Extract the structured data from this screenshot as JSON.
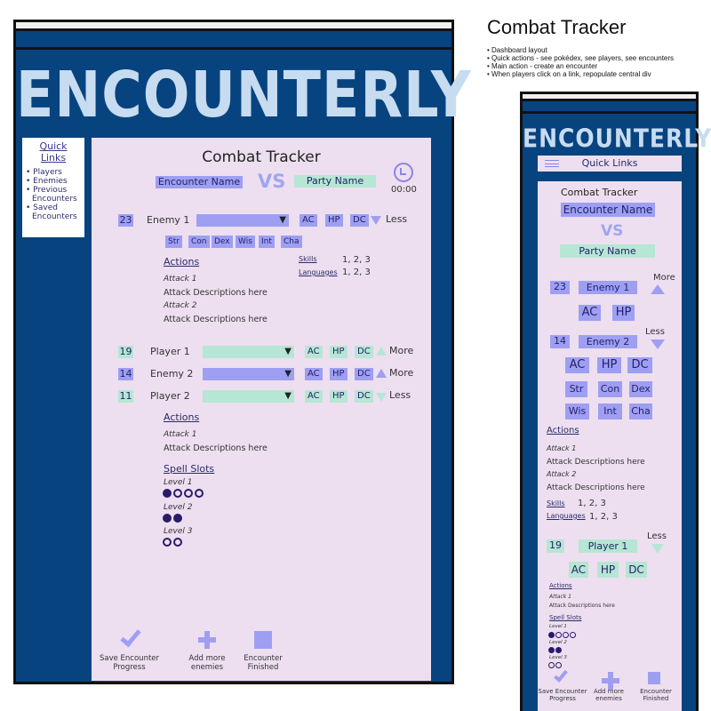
{
  "app": {
    "logo": "ENCOUNTERLY"
  },
  "quick_links": {
    "title": "Quick Links",
    "items": [
      "Players",
      "Enemies",
      "Previous Encounters",
      "Saved Encounters"
    ]
  },
  "tracker": {
    "title": "Combat Tracker",
    "encounter_name": "Encounter Name",
    "vs": "VS",
    "party_name": "Party Name",
    "timer": "00:00",
    "rows": [
      {
        "initiative": "23",
        "name": "Enemy 1",
        "toggle": "Less"
      },
      {
        "initiative": "19",
        "name": "Player 1",
        "toggle": "More"
      },
      {
        "initiative": "14",
        "name": "Enemy 2",
        "toggle": "More"
      },
      {
        "initiative": "11",
        "name": "Player 2",
        "toggle": "Less"
      }
    ],
    "stats": [
      "AC",
      "HP",
      "DC"
    ],
    "attributes": [
      "Str",
      "Con",
      "Dex",
      "Wis",
      "Int",
      "Cha"
    ],
    "actions_title": "Actions",
    "attack1": "Attack 1",
    "attack2": "Attack 2",
    "attack_desc": "Attack Descriptions here",
    "skills_label": "Skills",
    "skills_value": "1, 2, 3",
    "languages_label": "Languages",
    "languages_value": "1, 2, 3",
    "spell_slots_title": "Spell Slots",
    "level1": "Level 1",
    "level2": "Level 2",
    "level3": "Level 3",
    "footer": {
      "save_line1": "Save Encounter",
      "save_line2": "Progress",
      "add_line1": "Add more",
      "add_line2": "enemies",
      "finish_line1": "Encounter",
      "finish_line2": "Finished"
    }
  },
  "notes": {
    "title": "Combat Tracker",
    "items": [
      "Dashboard layout",
      "Quick actions - see pokédex, see players, see encounters",
      "Main action - create an encounter",
      "When players click on a link, repopulate central div"
    ]
  },
  "mobile": {
    "quick_links_label": "Quick Links",
    "toggle_more": "More",
    "toggle_less": "Less"
  },
  "colors": {
    "frame_bg": "#07437f",
    "panel_bg": "#eddff0",
    "enemy_highlight": "#9e9ff2",
    "player_highlight": "#b6e6d4",
    "logo": "#c7dcf0"
  },
  "spell_slots": {
    "level1": {
      "filled": 1,
      "total": 4
    },
    "level2": {
      "filled": 2,
      "total": 2
    },
    "level3": {
      "filled": 0,
      "total": 2
    }
  }
}
